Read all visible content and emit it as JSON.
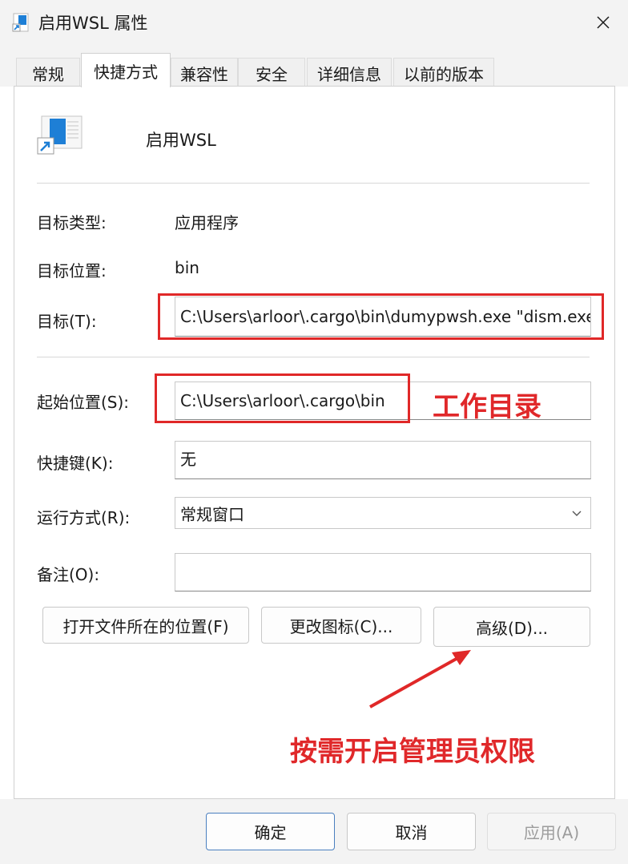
{
  "window": {
    "title": "启用WSL 属性"
  },
  "tabs": [
    {
      "label": "常规"
    },
    {
      "label": "快捷方式",
      "active": true
    },
    {
      "label": "兼容性"
    },
    {
      "label": "安全"
    },
    {
      "label": "详细信息"
    },
    {
      "label": "以前的版本"
    }
  ],
  "shortcut": {
    "name": "启用WSL"
  },
  "fields": {
    "target_type_label": "目标类型:",
    "target_type_value": "应用程序",
    "target_location_label": "目标位置:",
    "target_location_value": "bin",
    "target_label": "目标(T):",
    "target_value": "C:\\Users\\arloor\\.cargo\\bin\\dumypwsh.exe \"dism.exe",
    "start_in_label": "起始位置(S):",
    "start_in_value": "C:\\Users\\arloor\\.cargo\\bin",
    "hotkey_label": "快捷键(K):",
    "hotkey_value": "无",
    "run_label": "运行方式(R):",
    "run_value": "常规窗口",
    "comment_label": "备注(O):",
    "comment_value": ""
  },
  "buttons": {
    "open_location": "打开文件所在的位置(F)",
    "change_icon": "更改图标(C)...",
    "advanced": "高级(D)..."
  },
  "footer": {
    "ok": "确定",
    "cancel": "取消",
    "apply": "应用(A)"
  },
  "annotations": {
    "working_dir": "工作目录",
    "admin_note": "按需开启管理员权限"
  },
  "colors": {
    "annotation_red": "#e02828",
    "accent_blue": "#1e7fd6"
  }
}
